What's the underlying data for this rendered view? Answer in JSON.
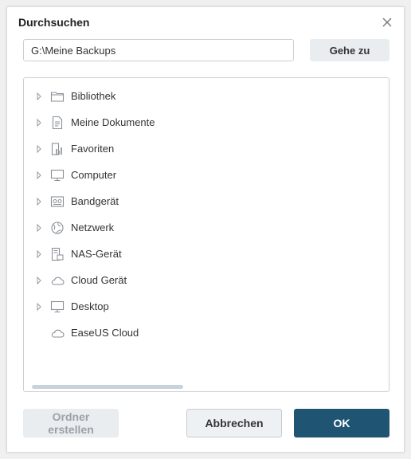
{
  "dialog": {
    "title": "Durchsuchen",
    "close_icon": "close-icon"
  },
  "path": {
    "value": "G:\\Meine Backups",
    "goto_label": "Gehe zu"
  },
  "tree": {
    "items": [
      {
        "label": "Bibliothek",
        "icon": "folder-icon",
        "expandable": true
      },
      {
        "label": "Meine Dokumente",
        "icon": "document-icon",
        "expandable": true
      },
      {
        "label": "Favoriten",
        "icon": "favorites-icon",
        "expandable": true
      },
      {
        "label": "Computer",
        "icon": "computer-icon",
        "expandable": true
      },
      {
        "label": "Bandgerät",
        "icon": "tape-device-icon",
        "expandable": true
      },
      {
        "label": "Netzwerk",
        "icon": "network-icon",
        "expandable": true
      },
      {
        "label": "NAS-Gerät",
        "icon": "nas-device-icon",
        "expandable": true
      },
      {
        "label": "Cloud Gerät",
        "icon": "cloud-icon",
        "expandable": true
      },
      {
        "label": "Desktop",
        "icon": "desktop-icon",
        "expandable": true
      },
      {
        "label": "EaseUS Cloud",
        "icon": "cloud-icon",
        "expandable": false
      }
    ]
  },
  "buttons": {
    "create_folder": "Ordner erstellen",
    "cancel": "Abbrechen",
    "ok": "OK"
  },
  "colors": {
    "primary": "#1f5472",
    "icon": "#8a8f95"
  }
}
